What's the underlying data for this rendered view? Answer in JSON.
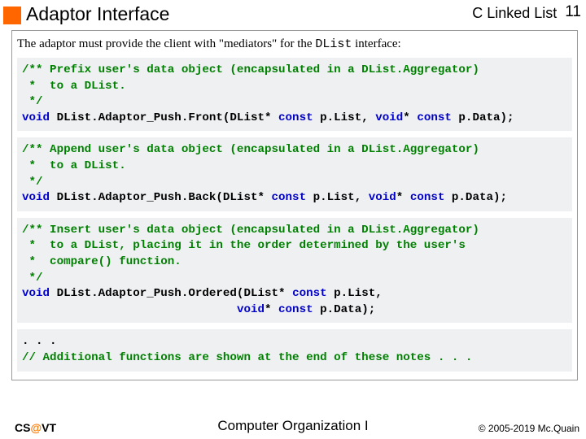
{
  "header": {
    "title": "Adaptor Interface",
    "topic": "C Linked List",
    "slide_number": "11"
  },
  "intro": {
    "prefix": "The adaptor must provide the client with \"mediators\" for the ",
    "code": "DList",
    "suffix": " interface:"
  },
  "code": {
    "block1": {
      "c1": "/** Prefix user's data object (encapsulated in a DList.Aggregator)",
      "c2": " *  to a DList.",
      "c3": " */",
      "kw_void": "void",
      "fn": " DList.Adaptor_Push.Front(DList* ",
      "kw_const1": "const",
      "mid": " p.List, ",
      "kw_voidp": "void",
      "star": "* ",
      "kw_const2": "const",
      "end": " p.Data);"
    },
    "block2": {
      "c1": "/** Append user's data object (encapsulated in a DList.Aggregator)",
      "c2": " *  to a DList.",
      "c3": " */",
      "kw_void": "void",
      "fn": " DList.Adaptor_Push.Back(DList* ",
      "kw_const1": "const",
      "mid": " p.List, ",
      "kw_voidp": "void",
      "star": "* ",
      "kw_const2": "const",
      "end": " p.Data);"
    },
    "block3": {
      "c1": "/** Insert user's data object (encapsulated in a DList.Aggregator)",
      "c2": " *  to a DList, placing it in the order determined by the user's",
      "c3": " *  compare() function.",
      "c4": " */",
      "kw_void": "void",
      "fn": " DList.Adaptor_Push.Ordered(DList* ",
      "kw_const1": "const",
      "mid": " p.List,",
      "line2_pad": "                               ",
      "kw_voidp": "void",
      "star": "* ",
      "kw_const2": "const",
      "end": " p.Data);"
    },
    "block4": {
      "l1": ". . .",
      "l2": "// Additional functions are shown at the end of these notes . . ."
    }
  },
  "footer": {
    "left_cs": "CS",
    "left_at": "@",
    "left_vt": "VT",
    "center": "Computer Organization I",
    "right": "© 2005-2019 Mc.Quain"
  }
}
